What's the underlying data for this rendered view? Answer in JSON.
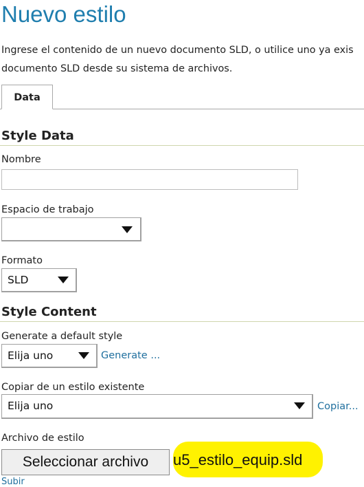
{
  "page": {
    "title": "Nuevo estilo",
    "description_line1": "Ingrese el contenido de un nuevo documento SLD, o utilice uno ya exis",
    "description_line2": "documento SLD desde su sistema de archivos."
  },
  "tabs": [
    {
      "label": "Data",
      "selected": true
    }
  ],
  "style_data": {
    "heading": "Style Data",
    "name_label": "Nombre",
    "name_value": "",
    "workspace_label": "Espacio de trabajo",
    "workspace_value": "",
    "format_label": "Formato",
    "format_value": "SLD"
  },
  "style_content": {
    "heading": "Style Content",
    "generate_label": "Generate a default style",
    "generate_select": "Elija uno",
    "generate_link": "Generate ...",
    "copy_label": "Copiar de un estilo existente",
    "copy_select": "Elija uno",
    "copy_link": "Copiar...",
    "file_label": "Archivo de estilo",
    "file_button": "Seleccionar archivo",
    "file_name": "u5_estilo_equip.sld",
    "upload_link": "Subir"
  },
  "colors": {
    "title_blue": "#1f7eae",
    "link_blue": "#1f6f9e",
    "section_rule": "#cfd6ad",
    "highlight": "#fff200"
  },
  "icons": {
    "dropdown": "triangle-down"
  }
}
